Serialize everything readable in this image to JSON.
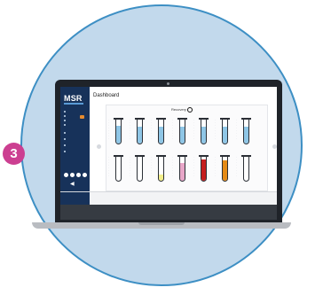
{
  "step_badge": "3",
  "app": {
    "logo": "MSR",
    "title": "Dashboard",
    "recovery_label": "Recovery"
  },
  "colors": {
    "circle_bg": "#c2d9ec",
    "circle_border": "#3d8fc4",
    "badge": "#cc3f91",
    "sidebar": "#17325a",
    "liquid_blue": "#8fc6e6",
    "liquid_yellow": "#f2ee8a",
    "liquid_pink": "#e8a6c8",
    "liquid_red": "#c41d1d",
    "liquid_orange": "#e58b16"
  },
  "tubes_row1": [
    {
      "liquid": "blue",
      "level": 0.75
    },
    {
      "liquid": "blue",
      "level": 0.72
    },
    {
      "liquid": "blue",
      "level": 0.72
    },
    {
      "liquid": "blue",
      "level": 0.72
    },
    {
      "liquid": "blue",
      "level": 0.72
    },
    {
      "liquid": "blue",
      "level": 0.72
    },
    {
      "liquid": "blue",
      "level": 0.72
    }
  ],
  "tubes_row2": [
    {
      "liquid": "blue",
      "level": 0.0
    },
    {
      "liquid": "blue",
      "level": 0.0
    },
    {
      "liquid": "yellow",
      "level": 0.25
    },
    {
      "liquid": "pink",
      "level": 0.75
    },
    {
      "liquid": "red",
      "level": 0.9
    },
    {
      "liquid": "orange",
      "level": 0.85
    },
    {
      "liquid": "blue",
      "level": 0.0
    }
  ]
}
